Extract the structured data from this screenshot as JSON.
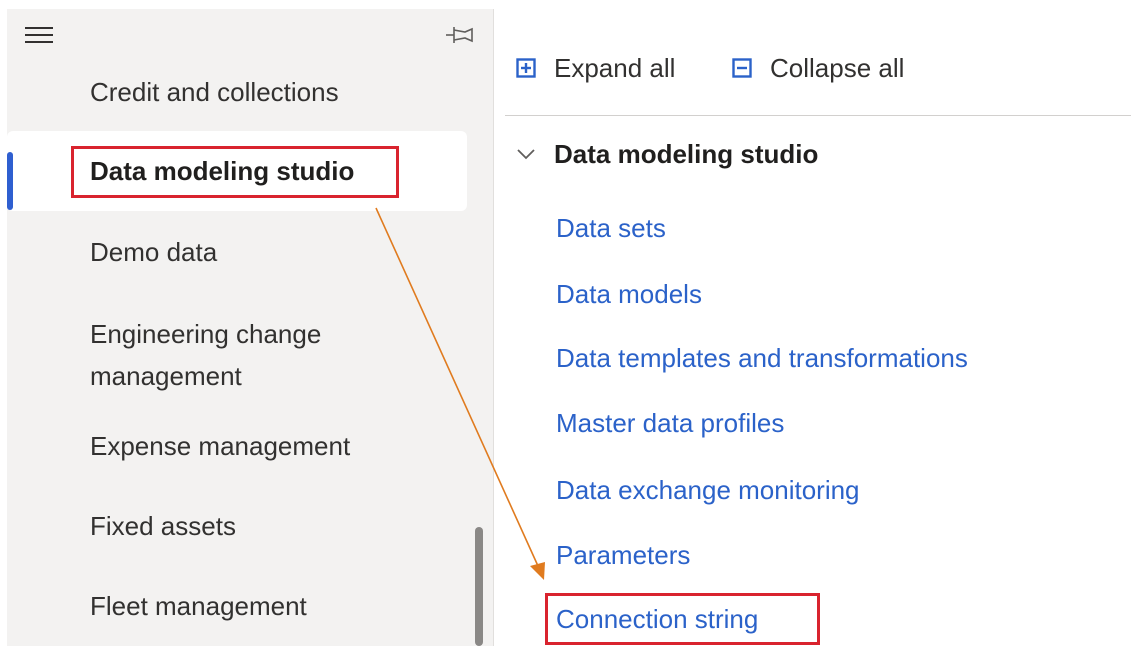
{
  "nav": {
    "items": [
      {
        "label": "Credit and collections"
      },
      {
        "label": "Data modeling studio",
        "selected": true
      },
      {
        "label": "Demo data"
      },
      {
        "label": "Engineering change management"
      },
      {
        "label": "Expense management"
      },
      {
        "label": "Fixed assets"
      },
      {
        "label": "Fleet management"
      }
    ]
  },
  "toolbar": {
    "expand_label": "Expand all",
    "collapse_label": "Collapse all"
  },
  "group": {
    "title": "Data modeling studio",
    "expanded": true,
    "links": [
      {
        "label": "Data sets"
      },
      {
        "label": "Data models"
      },
      {
        "label": "Data templates and transformations"
      },
      {
        "label": "Master data profiles"
      },
      {
        "label": "Data exchange monitoring"
      },
      {
        "label": "Parameters"
      },
      {
        "label": "Connection string"
      }
    ]
  },
  "colors": {
    "accent": "#2f5fd0",
    "link": "#2b62c9",
    "highlight_box": "#d9232e",
    "arrow": "#e07b1f",
    "nav_background": "#f3f2f1"
  },
  "icons": {
    "menu": "hamburger-menu-icon",
    "pin": "pin-icon",
    "expand": "expand-all-icon",
    "collapse": "collapse-all-icon",
    "chevron": "chevron-down-icon"
  }
}
